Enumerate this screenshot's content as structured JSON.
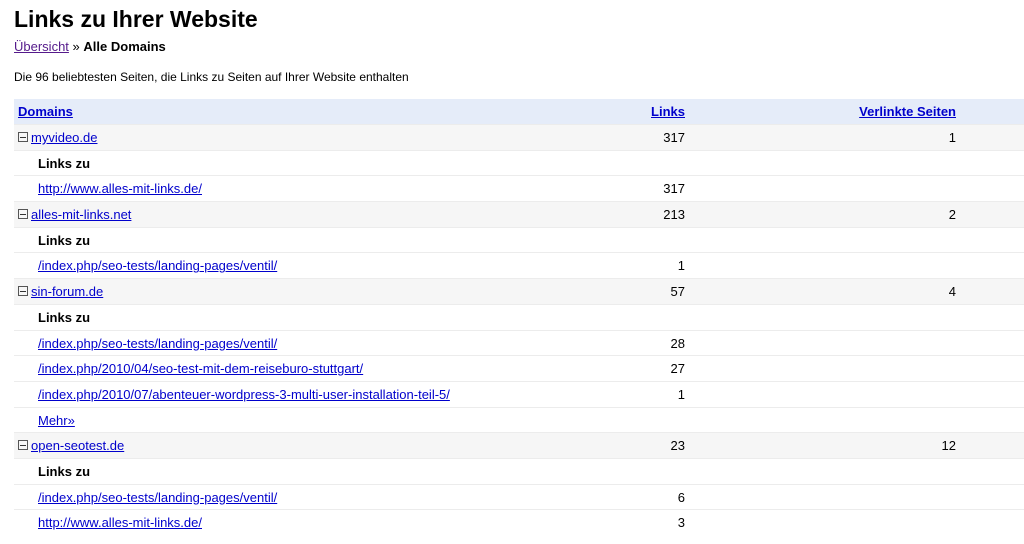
{
  "page": {
    "title": "Links zu Ihrer Website",
    "breadcrumb": {
      "overview": "Übersicht",
      "separator": "»",
      "current": "Alle Domains"
    },
    "description": "Die 96 beliebtesten Seiten, die Links zu Seiten auf Ihrer Website enthalten"
  },
  "table": {
    "headers": {
      "domains": "Domains",
      "links": "Links",
      "pages": "Verlinkte Seiten"
    },
    "links_to_label": "Links zu",
    "more_label": "Mehr»",
    "domains": [
      {
        "domain": "myvideo.de",
        "links": "317",
        "pages": "1",
        "targets": [
          {
            "url": "http://www.alles-mit-links.de/",
            "count": "317"
          }
        ]
      },
      {
        "domain": "alles-mit-links.net",
        "links": "213",
        "pages": "2",
        "targets": [
          {
            "url": "/index.php/seo-tests/landing-pages/ventil/",
            "count": "1"
          }
        ]
      },
      {
        "domain": "sin-forum.de",
        "links": "57",
        "pages": "4",
        "targets": [
          {
            "url": "/index.php/seo-tests/landing-pages/ventil/",
            "count": "28"
          },
          {
            "url": "/index.php/2010/04/seo-test-mit-dem-reiseburo-stuttgart/",
            "count": "27"
          },
          {
            "url": "/index.php/2010/07/abenteuer-wordpress-3-multi-user-installation-teil-5/",
            "count": "1"
          }
        ],
        "has_more": true
      },
      {
        "domain": "open-seotest.de",
        "links": "23",
        "pages": "12",
        "targets": [
          {
            "url": "/index.php/seo-tests/landing-pages/ventil/",
            "count": "6"
          },
          {
            "url": "http://www.alles-mit-links.de/",
            "count": "3"
          }
        ]
      }
    ]
  }
}
